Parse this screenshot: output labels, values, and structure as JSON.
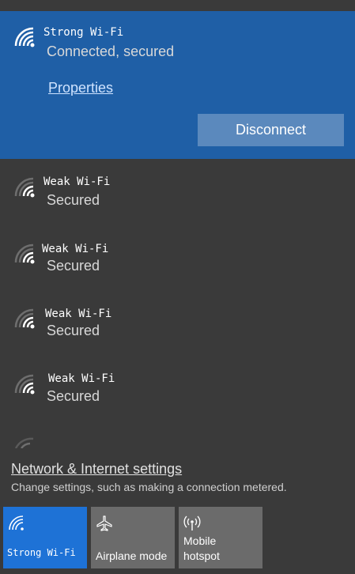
{
  "connected_network": {
    "name": "Strong Wi-Fi",
    "status": "Connected, secured",
    "properties_label": "Properties",
    "disconnect_label": "Disconnect"
  },
  "networks": [
    {
      "name": "Weak Wi-Fi",
      "status": "Secured"
    },
    {
      "name": "Weak Wi-Fi",
      "status": "Secured"
    },
    {
      "name": "Weak Wi-Fi",
      "status": "Secured"
    },
    {
      "name": "Weak Wi-Fi",
      "status": "Secured"
    }
  ],
  "settings": {
    "link_label": "Network & Internet settings",
    "description": "Change settings, such as making a connection metered."
  },
  "quick_actions": [
    {
      "label": "Strong Wi-Fi",
      "icon": "wifi-icon",
      "active": true
    },
    {
      "label": "Airplane mode",
      "icon": "airplane-icon",
      "active": false
    },
    {
      "label": "Mobile hotspot",
      "icon": "hotspot-icon",
      "active": false
    }
  ],
  "colors": {
    "background": "#3a3a3a",
    "connected_bg": "#1f5fa6",
    "accent": "#1e72d6",
    "tile_bg": "#6b6b6b"
  }
}
